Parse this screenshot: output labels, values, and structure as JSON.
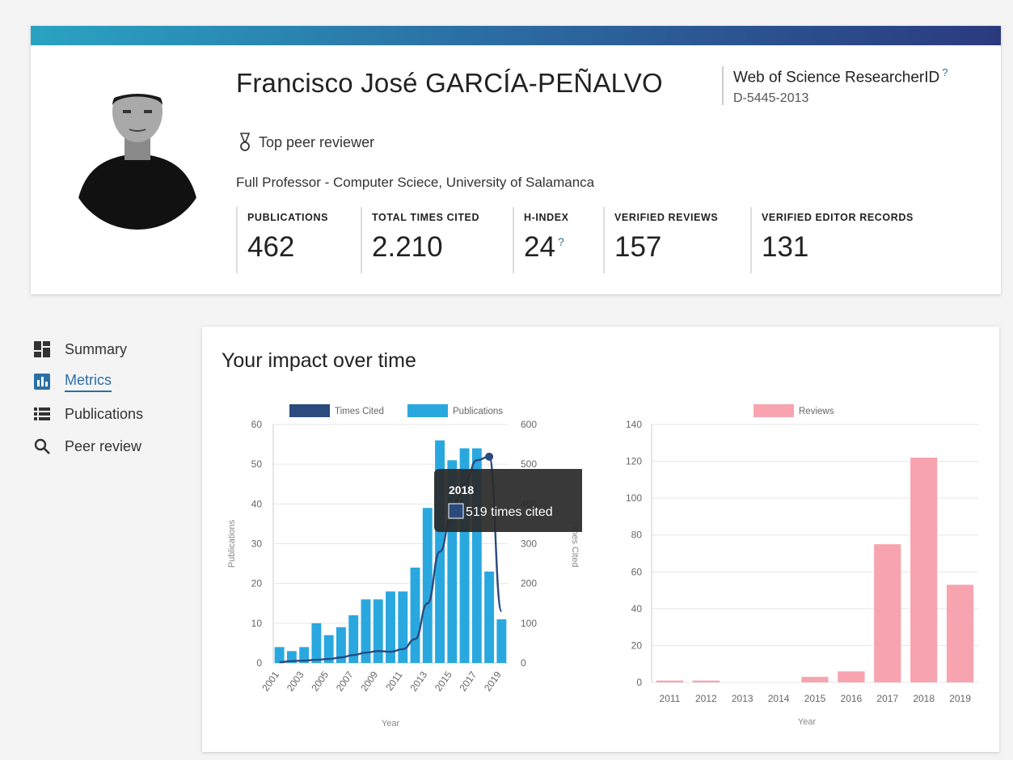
{
  "profile": {
    "name": "Francisco José GARCÍA-PEÑALVO",
    "badge": "Top peer reviewer",
    "affiliation": "Full Professor - Computer Sciece, University of Salamanca",
    "researcher_id_label": "Web of Science ResearcherID",
    "researcher_id": "D-5445-2013",
    "help_glyph": "?",
    "stats": [
      {
        "label": "PUBLICATIONS",
        "value": "462"
      },
      {
        "label": "TOTAL TIMES CITED",
        "value": "2.210"
      },
      {
        "label": "H-INDEX",
        "value": "24"
      },
      {
        "label": "VERIFIED REVIEWS",
        "value": "157"
      },
      {
        "label": "VERIFIED EDITOR RECORDS",
        "value": "131"
      }
    ]
  },
  "nav": {
    "items": [
      {
        "label": "Summary",
        "icon": "dashboard-icon"
      },
      {
        "label": "Metrics",
        "icon": "bar-chart-icon",
        "active": true
      },
      {
        "label": "Publications",
        "icon": "list-icon"
      },
      {
        "label": "Peer review",
        "icon": "search-icon"
      }
    ]
  },
  "metrics": {
    "title": "Your impact over time"
  },
  "colors": {
    "publications": "#29a8e0",
    "times_cited": "#2b4a7e",
    "reviews": "#f7a4b0",
    "accent": "#2b6fa4"
  },
  "chart_data": [
    {
      "type": "bar",
      "categories": [
        "2001",
        "2002",
        "2003",
        "2004",
        "2005",
        "2006",
        "2007",
        "2008",
        "2009",
        "2010",
        "2011",
        "2012",
        "2013",
        "2014",
        "2015",
        "2016",
        "2017",
        "2018",
        "2019"
      ],
      "x_tick_labels": [
        "2001",
        "2003",
        "2005",
        "2007",
        "2009",
        "2011",
        "2013",
        "2015",
        "2017",
        "2019"
      ],
      "series": [
        {
          "name": "Publications",
          "type": "bar",
          "axis": "left",
          "values": [
            4,
            3,
            4,
            10,
            7,
            9,
            12,
            16,
            16,
            18,
            18,
            24,
            39,
            56,
            51,
            54,
            54,
            23,
            11
          ]
        },
        {
          "name": "Times Cited",
          "type": "line",
          "axis": "right",
          "values": [
            2,
            5,
            6,
            8,
            10,
            14,
            20,
            26,
            30,
            28,
            35,
            60,
            150,
            280,
            380,
            450,
            510,
            519,
            130
          ]
        }
      ],
      "xlabel": "Year",
      "ylabel": "Publications",
      "y2label": "Times Cited",
      "ylim": [
        0,
        60
      ],
      "y2lim": [
        0,
        600
      ],
      "yticks": [
        0,
        10,
        20,
        30,
        40,
        50,
        60
      ],
      "y2ticks": [
        0,
        100,
        200,
        300,
        400,
        500,
        600
      ],
      "tooltip": {
        "title": "2018",
        "text": "519 times cited"
      },
      "legend": "top"
    },
    {
      "type": "bar",
      "categories": [
        "2011",
        "2012",
        "2013",
        "2014",
        "2015",
        "2016",
        "2017",
        "2018",
        "2019"
      ],
      "series": [
        {
          "name": "Reviews",
          "values": [
            1,
            1,
            0,
            0,
            3,
            6,
            75,
            122,
            53
          ]
        }
      ],
      "xlabel": "Year",
      "ylim": [
        0,
        140
      ],
      "yticks": [
        0,
        20,
        40,
        60,
        80,
        100,
        120,
        140
      ],
      "legend": "top"
    }
  ]
}
